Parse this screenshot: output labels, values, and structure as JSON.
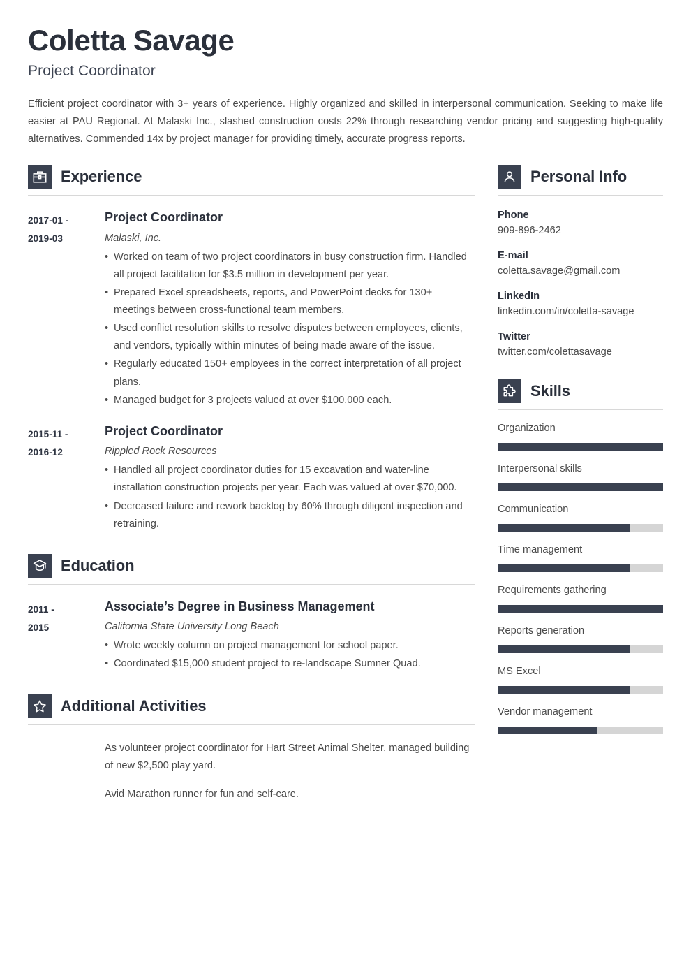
{
  "header": {
    "name": "Coletta Savage",
    "job_title": "Project Coordinator",
    "summary": "Efficient project coordinator with 3+ years of experience. Highly organized and skilled in interpersonal communication. Seeking to make life easier at PAU Regional. At Malaski Inc., slashed construction costs 22% through researching vendor pricing and suggesting high-quality alternatives. Commended 14x by project manager for providing timely, accurate progress reports."
  },
  "colors": {
    "accent_dark": "#3a4150",
    "heading": "#2b303b",
    "body_text": "#4a4a4a",
    "rule": "#d8d8d8",
    "skill_track": "#d5d5d5"
  },
  "sections": {
    "experience": {
      "title": "Experience",
      "icon": "briefcase-icon",
      "entries": [
        {
          "dates_from": "2017-01 -",
          "dates_to": "2019-03",
          "role": "Project Coordinator",
          "organization": "Malaski, Inc.",
          "bullets": [
            "Worked on team of two project coordinators in busy construction firm. Handled all project facilitation for $3.5 million in development per year.",
            "Prepared Excel spreadsheets, reports, and PowerPoint decks for 130+ meetings between cross-functional team members.",
            "Used conflict resolution skills to resolve disputes between employees, clients, and vendors, typically within minutes of being made aware of the issue.",
            "Regularly educated 150+ employees in the correct interpretation of all project plans.",
            "Managed budget for 3 projects valued at over $100,000 each."
          ]
        },
        {
          "dates_from": "2015-11 -",
          "dates_to": "2016-12",
          "role": "Project Coordinator",
          "organization": "Rippled Rock Resources",
          "bullets": [
            "Handled all project coordinator duties for 15 excavation and water-line installation construction projects per year. Each was valued at over $70,000.",
            "Decreased failure and rework backlog by 60% through diligent inspection and retraining."
          ]
        }
      ]
    },
    "education": {
      "title": "Education",
      "icon": "graduation-cap-icon",
      "entries": [
        {
          "dates_from": "2011 -",
          "dates_to": "2015",
          "role": "Associate’s Degree in Business Management",
          "organization": "California State University Long Beach",
          "bullets": [
            "Wrote weekly column on project management for school paper.",
            "Coordinated $15,000 student project to re-landscape Sumner Quad."
          ]
        }
      ]
    },
    "activities": {
      "title": "Additional Activities",
      "icon": "star-icon",
      "paragraphs": [
        "As volunteer project coordinator for Hart Street Animal Shelter, managed building of new $2,500 play yard.",
        "Avid Marathon runner for fun and self-care."
      ]
    },
    "personal_info": {
      "title": "Personal Info",
      "icon": "person-icon",
      "fields": [
        {
          "label": "Phone",
          "value": "909-896-2462"
        },
        {
          "label": "E-mail",
          "value": "coletta.savage@gmail.com"
        },
        {
          "label": "LinkedIn",
          "value": "linkedin.com/in/coletta-savage"
        },
        {
          "label": "Twitter",
          "value": "twitter.com/colettasavage"
        }
      ]
    },
    "skills": {
      "title": "Skills",
      "icon": "puzzle-piece-icon",
      "items": [
        {
          "name": "Organization",
          "level": 100
        },
        {
          "name": " Interpersonal skills",
          "level": 100
        },
        {
          "name": "Communication",
          "level": 80
        },
        {
          "name": "Time management",
          "level": 80
        },
        {
          "name": "Requirements gathering",
          "level": 100
        },
        {
          "name": "Reports generation",
          "level": 80
        },
        {
          "name": "MS Excel",
          "level": 80
        },
        {
          "name": "Vendor management",
          "level": 60
        }
      ]
    }
  }
}
